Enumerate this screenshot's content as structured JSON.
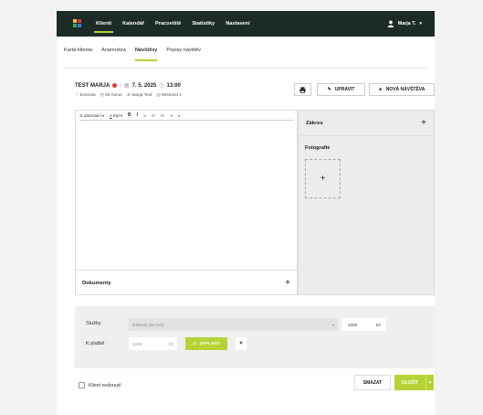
{
  "nav": {
    "items": [
      "Klienti",
      "Kalendář",
      "Pracoviště",
      "Statistiky",
      "Nastavení"
    ],
    "user": "Marja T."
  },
  "tabs": [
    "Karta klienta",
    "Anamnéza",
    "Návštěvy",
    "Popisy návštěv"
  ],
  "visit": {
    "client": "TEST MARJA",
    "date": "7. 5. 2025",
    "time": "13:00",
    "type": "kontrola",
    "duration": "50 minut",
    "staff": "Marja Test",
    "room": "Místnost 1"
  },
  "buttons": {
    "edit": "UPRAVIT",
    "new_visit": "NOVÁ NÁVŠTĚVA",
    "pay": "ZAPLATIT",
    "delete": "SMAZAT",
    "save": "ULOŽIT"
  },
  "editor": {
    "format": "Zarovnání",
    "font": "Styl",
    "bold": "B",
    "italic": "I"
  },
  "panels": {
    "documents": "Dokumenty",
    "procedure": "Zákres",
    "photos": "Fotografie"
  },
  "billing": {
    "services_label": "Služby",
    "service_value": "kontrola (50 min)",
    "price": "1000",
    "currency": "Kč",
    "to_pay_label": "K platbě",
    "to_pay_value": "1000"
  },
  "footer": {
    "no_show_label": "Klient nedorazil"
  },
  "colors": {
    "topbar": "#1c2b26",
    "accent": "#b5d334",
    "status_dot": "#e53935"
  }
}
